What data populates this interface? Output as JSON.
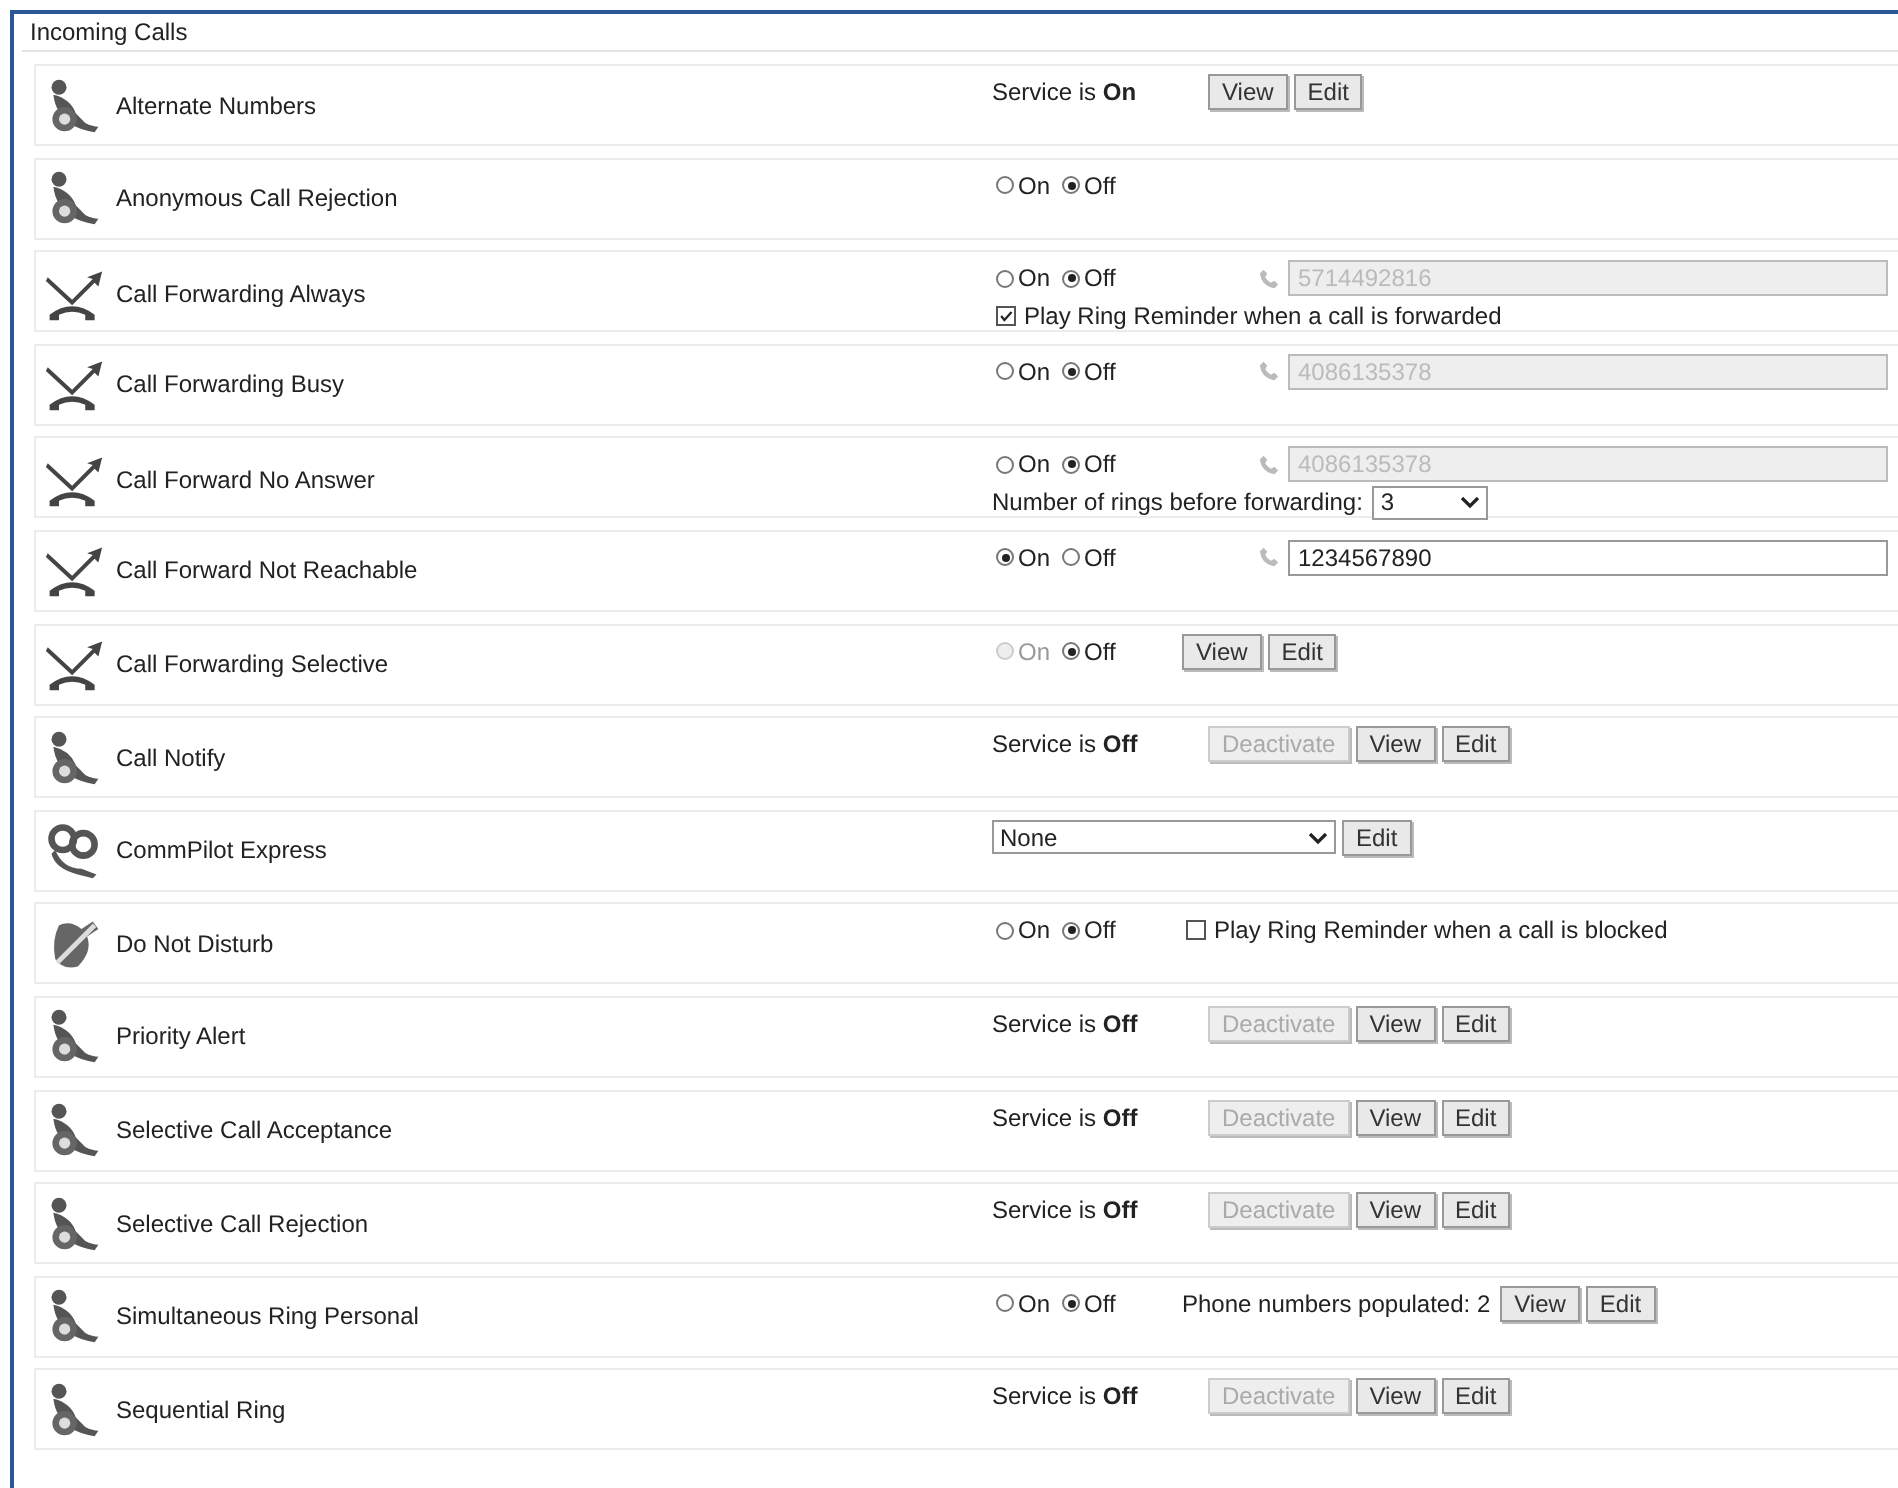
{
  "section": {
    "title": "Incoming Calls"
  },
  "rows": [
    {
      "name": "Alternate Numbers",
      "kind": "person",
      "lines": [
        [
          {
            "kind": "status",
            "text": "Service is **On**"
          },
          {
            "kind": "button",
            "label": "View",
            "disabled": false
          },
          {
            "kind": "button",
            "label": "Edit",
            "disabled": false
          }
        ]
      ]
    },
    {
      "name": "Anonymous Call Rejection",
      "kind": "person",
      "lines": [
        [
          {
            "kind": "radio",
            "options": [
              {
                "label": "On",
                "selected": false,
                "disabled": false
              },
              {
                "label": "Off",
                "selected": true,
                "disabled": false
              }
            ]
          }
        ]
      ]
    },
    {
      "name": "Call Forwarding Always",
      "kind": "forward",
      "lines": [
        [
          {
            "kind": "radio",
            "options": [
              {
                "label": "On",
                "selected": false,
                "disabled": false
              },
              {
                "label": "Off",
                "selected": true,
                "disabled": false
              }
            ]
          },
          {
            "kind": "phone",
            "value": "5714492816",
            "disabled": true
          }
        ],
        [
          {
            "kind": "checkbox",
            "label": "Play Ring Reminder when a call is forwarded",
            "checked": true
          }
        ]
      ]
    },
    {
      "name": "Call Forwarding Busy",
      "kind": "forward",
      "lines": [
        [
          {
            "kind": "radio",
            "options": [
              {
                "label": "On",
                "selected": false,
                "disabled": false
              },
              {
                "label": "Off",
                "selected": true,
                "disabled": false
              }
            ]
          },
          {
            "kind": "phone",
            "value": "4086135378",
            "disabled": true
          }
        ]
      ]
    },
    {
      "name": "Call Forward No Answer",
      "kind": "forward",
      "lines": [
        [
          {
            "kind": "radio",
            "options": [
              {
                "label": "On",
                "selected": false,
                "disabled": false
              },
              {
                "label": "Off",
                "selected": true,
                "disabled": false
              }
            ]
          },
          {
            "kind": "phone",
            "value": "4086135378",
            "disabled": true
          }
        ],
        [
          {
            "kind": "text",
            "text": "Number of rings before forwarding:"
          },
          {
            "kind": "select",
            "value": "3"
          }
        ]
      ]
    },
    {
      "name": "Call Forward Not Reachable",
      "kind": "forward",
      "lines": [
        [
          {
            "kind": "radio",
            "options": [
              {
                "label": "On",
                "selected": true,
                "disabled": false
              },
              {
                "label": "Off",
                "selected": false,
                "disabled": false
              }
            ]
          },
          {
            "kind": "phone",
            "value": "1234567890",
            "disabled": false
          }
        ]
      ]
    },
    {
      "name": "Call Forwarding Selective",
      "kind": "forward",
      "lines": [
        [
          {
            "kind": "radio",
            "options": [
              {
                "label": "On",
                "selected": false,
                "disabled": true
              },
              {
                "label": "Off",
                "selected": true,
                "disabled": false
              }
            ]
          },
          {
            "kind": "button",
            "label": "View",
            "disabled": false
          },
          {
            "kind": "button",
            "label": "Edit",
            "disabled": false
          }
        ]
      ]
    },
    {
      "name": "Call Notify",
      "kind": "person",
      "lines": [
        [
          {
            "kind": "status",
            "text": "Service is **Off**"
          },
          {
            "kind": "button",
            "label": "Deactivate",
            "disabled": true
          },
          {
            "kind": "button",
            "label": "View",
            "disabled": false
          },
          {
            "kind": "button",
            "label": "Edit",
            "disabled": false
          }
        ]
      ]
    },
    {
      "name": "CommPilot Express",
      "kind": "link",
      "lines": [
        [
          {
            "kind": "select",
            "value": "None"
          },
          {
            "kind": "button",
            "label": "Edit",
            "disabled": false
          }
        ]
      ]
    },
    {
      "name": "Do Not Disturb",
      "kind": "dnd",
      "lines": [
        [
          {
            "kind": "radio",
            "options": [
              {
                "label": "On",
                "selected": false,
                "disabled": false
              },
              {
                "label": "Off",
                "selected": true,
                "disabled": false
              }
            ]
          },
          {
            "kind": "checkbox",
            "label": "Play Ring Reminder when a call is blocked",
            "checked": false
          }
        ]
      ]
    },
    {
      "name": "Priority Alert",
      "kind": "person",
      "lines": [
        [
          {
            "kind": "status",
            "text": "Service is **Off**"
          },
          {
            "kind": "button",
            "label": "Deactivate",
            "disabled": true
          },
          {
            "kind": "button",
            "label": "View",
            "disabled": false
          },
          {
            "kind": "button",
            "label": "Edit",
            "disabled": false
          }
        ]
      ]
    },
    {
      "name": "Selective Call Acceptance",
      "kind": "person",
      "lines": [
        [
          {
            "kind": "status",
            "text": "Service is **Off**"
          },
          {
            "kind": "button",
            "label": "Deactivate",
            "disabled": true
          },
          {
            "kind": "button",
            "label": "View",
            "disabled": false
          },
          {
            "kind": "button",
            "label": "Edit",
            "disabled": false
          }
        ]
      ]
    },
    {
      "name": "Selective Call Rejection",
      "kind": "person",
      "lines": [
        [
          {
            "kind": "status",
            "text": "Service is **Off**"
          },
          {
            "kind": "button",
            "label": "Deactivate",
            "disabled": true
          },
          {
            "kind": "button",
            "label": "View",
            "disabled": false
          },
          {
            "kind": "button",
            "label": "Edit",
            "disabled": false
          }
        ]
      ]
    },
    {
      "name": "Simultaneous Ring Personal",
      "kind": "person",
      "lines": [
        [
          {
            "kind": "radio",
            "options": [
              {
                "label": "On",
                "selected": false,
                "disabled": false
              },
              {
                "label": "Off",
                "selected": true,
                "disabled": false
              }
            ]
          },
          {
            "kind": "text",
            "text": "Phone numbers populated: 2"
          },
          {
            "kind": "button",
            "label": "View",
            "disabled": false
          },
          {
            "kind": "button",
            "label": "Edit",
            "disabled": false
          }
        ]
      ]
    },
    {
      "name": "Sequential Ring",
      "kind": "person",
      "lines": [
        [
          {
            "kind": "status",
            "text": "Service is **Off**"
          },
          {
            "kind": "button",
            "label": "Deactivate",
            "disabled": true
          },
          {
            "kind": "button",
            "label": "View",
            "disabled": false
          },
          {
            "kind": "button",
            "label": "Edit",
            "disabled": false
          }
        ]
      ]
    }
  ]
}
